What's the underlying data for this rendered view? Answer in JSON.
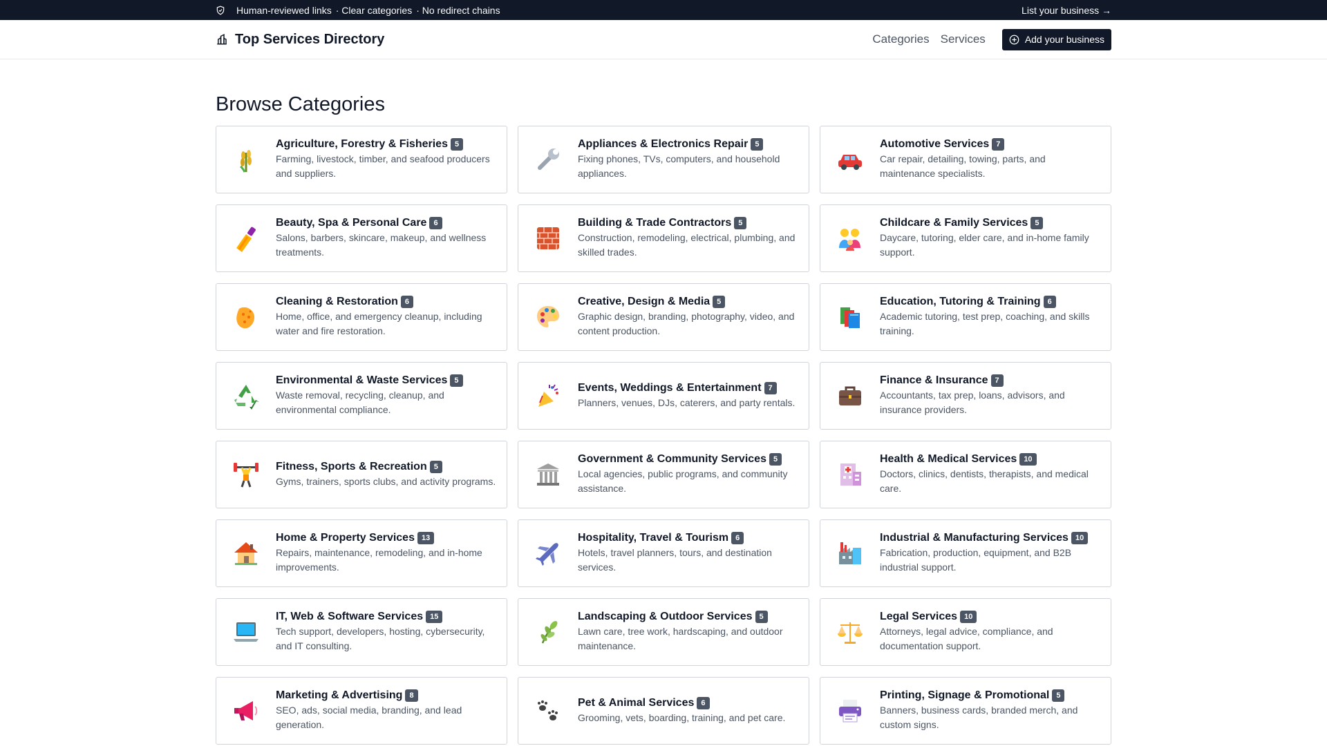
{
  "topbar": {
    "notes": [
      "Human-reviewed links",
      "· Clear categories",
      "· No redirect chains"
    ],
    "list_link": "List your business →"
  },
  "header": {
    "brand": "Top Services Directory",
    "nav": [
      "Categories",
      "Services"
    ],
    "add_button": "Add your business"
  },
  "page_title": "Browse Categories",
  "categories": [
    {
      "name": "Agriculture, Forestry & Fisheries",
      "count": "5",
      "desc": "Farming, livestock, timber, and seafood producers and suppliers.",
      "icon": "wheat-icon"
    },
    {
      "name": "Appliances & Electronics Repair",
      "count": "5",
      "desc": "Fixing phones, TVs, computers, and household appliances.",
      "icon": "wrench-icon"
    },
    {
      "name": "Automotive Services",
      "count": "7",
      "desc": "Car repair, detailing, towing, parts, and maintenance specialists.",
      "icon": "car-icon"
    },
    {
      "name": "Beauty, Spa & Personal Care",
      "count": "6",
      "desc": "Salons, barbers, skincare, makeup, and wellness treatments.",
      "icon": "nail-polish-icon"
    },
    {
      "name": "Building & Trade Contractors",
      "count": "5",
      "desc": "Construction, remodeling, electrical, plumbing, and skilled trades.",
      "icon": "bricks-icon"
    },
    {
      "name": "Childcare & Family Services",
      "count": "5",
      "desc": "Daycare, tutoring, elder care, and in-home family support.",
      "icon": "family-icon"
    },
    {
      "name": "Cleaning & Restoration",
      "count": "6",
      "desc": "Home, office, and emergency cleanup, including water and fire restoration.",
      "icon": "sponge-icon"
    },
    {
      "name": "Creative, Design & Media",
      "count": "5",
      "desc": "Graphic design, branding, photography, video, and content production.",
      "icon": "palette-icon"
    },
    {
      "name": "Education, Tutoring & Training",
      "count": "6",
      "desc": "Academic tutoring, test prep, coaching, and skills training.",
      "icon": "books-icon"
    },
    {
      "name": "Environmental & Waste Services",
      "count": "5",
      "desc": "Waste removal, recycling, cleanup, and environmental compliance.",
      "icon": "recycle-icon"
    },
    {
      "name": "Events, Weddings & Entertainment",
      "count": "7",
      "desc": "Planners, venues, DJs, caterers, and party rentals.",
      "icon": "party-popper-icon"
    },
    {
      "name": "Finance & Insurance",
      "count": "7",
      "desc": "Accountants, tax prep, loans, advisors, and insurance providers.",
      "icon": "briefcase-icon"
    },
    {
      "name": "Fitness, Sports & Recreation",
      "count": "5",
      "desc": "Gyms, trainers, sports clubs, and activity programs.",
      "icon": "weightlifter-icon"
    },
    {
      "name": "Government & Community Services",
      "count": "5",
      "desc": "Local agencies, public programs, and community assistance.",
      "icon": "classical-building-icon"
    },
    {
      "name": "Health & Medical Services",
      "count": "10",
      "desc": "Doctors, clinics, dentists, therapists, and medical care.",
      "icon": "hospital-icon"
    },
    {
      "name": "Home & Property Services",
      "count": "13",
      "desc": "Repairs, maintenance, remodeling, and in-home improvements.",
      "icon": "house-icon"
    },
    {
      "name": "Hospitality, Travel & Tourism",
      "count": "6",
      "desc": "Hotels, travel planners, tours, and destination services.",
      "icon": "airplane-icon"
    },
    {
      "name": "Industrial & Manufacturing Services",
      "count": "10",
      "desc": "Fabrication, production, equipment, and B2B industrial support.",
      "icon": "factory-icon"
    },
    {
      "name": "IT, Web & Software Services",
      "count": "15",
      "desc": "Tech support, developers, hosting, cybersecurity, and IT consulting.",
      "icon": "laptop-icon"
    },
    {
      "name": "Landscaping & Outdoor Services",
      "count": "5",
      "desc": "Lawn care, tree work, hardscaping, and outdoor maintenance.",
      "icon": "herb-icon"
    },
    {
      "name": "Legal Services",
      "count": "10",
      "desc": "Attorneys, legal advice, compliance, and documentation support.",
      "icon": "balance-scale-icon"
    },
    {
      "name": "Marketing & Advertising",
      "count": "8",
      "desc": "SEO, ads, social media, branding, and lead generation.",
      "icon": "megaphone-icon"
    },
    {
      "name": "Pet & Animal Services",
      "count": "6",
      "desc": "Grooming, vets, boarding, training, and pet care.",
      "icon": "paw-prints-icon"
    },
    {
      "name": "Printing, Signage & Promotional",
      "count": "5",
      "desc": "Banners, business cards, branded merch, and custom signs.",
      "icon": "printer-icon"
    }
  ]
}
